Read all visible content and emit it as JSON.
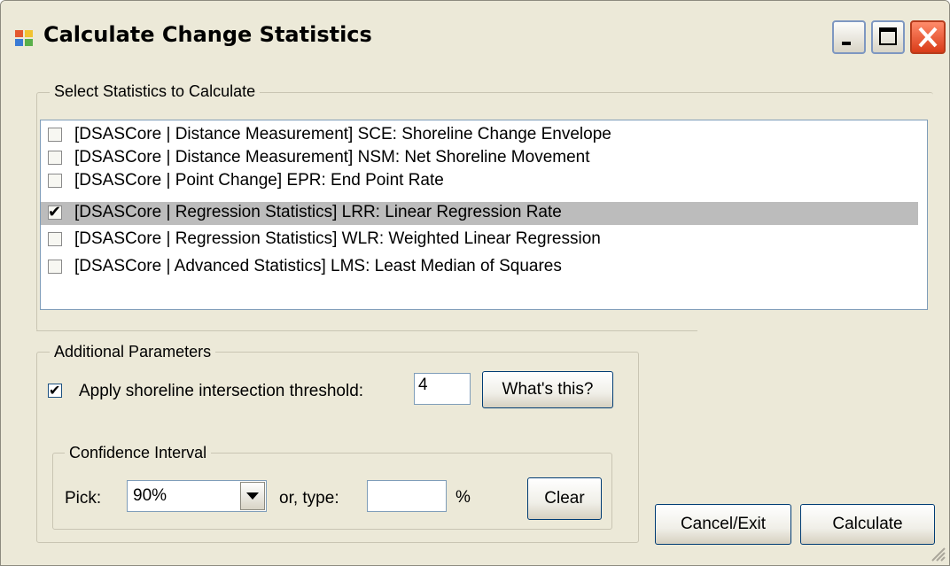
{
  "window": {
    "title": "Calculate Change Statistics",
    "controls": [
      "minimize",
      "maximize",
      "close"
    ]
  },
  "select_group": {
    "legend": "Select Statistics to Calculate",
    "items": [
      {
        "label": "[DSASCore | Distance Measurement] SCE: Shoreline Change Envelope",
        "checked": false,
        "selected": false
      },
      {
        "label": "[DSASCore | Distance Measurement] NSM: Net Shoreline Movement",
        "checked": false,
        "selected": false
      },
      {
        "label": "[DSASCore | Point Change] EPR: End Point Rate",
        "checked": false,
        "selected": false
      },
      {
        "label": "[DSASCore | Regression Statistics] LRR: Linear Regression Rate",
        "checked": true,
        "selected": true
      },
      {
        "label": "[DSASCore | Regression Statistics] WLR: Weighted Linear Regression",
        "checked": false,
        "selected": false
      },
      {
        "label": "[DSASCore | Advanced Statistics] LMS: Least Median of Squares",
        "checked": false,
        "selected": false
      }
    ]
  },
  "additional": {
    "legend": "Additional Parameters",
    "threshold_label": "Apply shoreline intersection threshold:",
    "threshold_checked": true,
    "threshold_value": "4",
    "whats_this": "What's this?"
  },
  "confidence": {
    "legend": "Confidence Interval",
    "pick_label": "Pick:",
    "pick_value": "90%",
    "or_type_label": "or, type:",
    "type_value": "",
    "percent": "%",
    "clear": "Clear"
  },
  "buttons": {
    "cancel": "Cancel/Exit",
    "calculate": "Calculate"
  },
  "icons": {
    "app": "app-window-icon",
    "check": "✔"
  }
}
